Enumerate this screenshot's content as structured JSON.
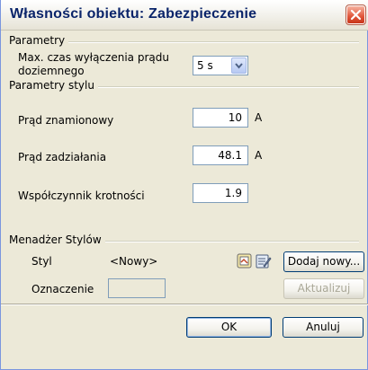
{
  "window": {
    "title": "Własności obiektu: Zabezpieczenie"
  },
  "groups": {
    "parametry": "Parametry",
    "parametry_stylu": "Parametry stylu",
    "menadzer": "Menadżer Stylów"
  },
  "parametry": {
    "czas_label_line1": "Max. czas wyłączenia prądu",
    "czas_label_line2": "doziemnego",
    "czas_value": "5 s"
  },
  "styl_params": [
    {
      "label": "Prąd znamionowy",
      "value": "10",
      "unit": "A"
    },
    {
      "label": "Prąd zadziałania",
      "value": "48.1",
      "unit": "A"
    },
    {
      "label": "Współczynnik krotności",
      "value": "1.9",
      "unit": ""
    }
  ],
  "menadzer": {
    "styl_label": "Styl",
    "styl_value": "<Nowy>",
    "oznaczenie_label": "Oznaczenie",
    "oznaczenie_value": "",
    "add_button": "Dodaj nowy...",
    "update_button": "Aktualizuj"
  },
  "footer": {
    "ok": "OK",
    "cancel": "Anuluj"
  },
  "colors": {
    "title_text": "#0a246a",
    "close_button": "#e0553a",
    "dialog_bg": "#ece9d8",
    "input_border": "#7f9db9"
  },
  "icons": [
    "close-icon",
    "dropdown-arrow-icon",
    "style-icon",
    "edit-style-icon"
  ]
}
